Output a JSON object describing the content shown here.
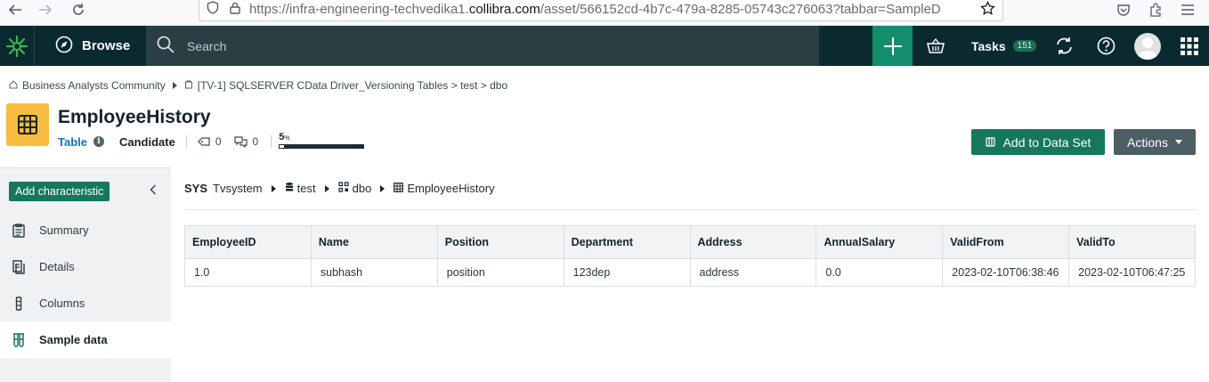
{
  "browser": {
    "url_prefix": "https://infra-engineering-techvedika1.",
    "url_domain": "collibra.com",
    "url_suffix": "/asset/566152cd-4b7c-479a-8285-05743c276063?tabbar=SampleD"
  },
  "header": {
    "browse_label": "Browse",
    "search_placeholder": "Search",
    "tasks_label": "Tasks",
    "tasks_count": "151"
  },
  "breadcrumb": {
    "community": "Business Analysts Community",
    "path": "[TV-1] SQLSERVER CData Driver_Versioning Tables > test > dbo"
  },
  "asset": {
    "title": "EmployeeHistory",
    "type": "Table",
    "status": "Candidate",
    "tags_count": "0",
    "comments_count": "0",
    "completeness_value": "5",
    "completeness_unit": "%",
    "completeness_fraction": 0.05
  },
  "actions": {
    "add_to_dataset": "Add to Data Set",
    "actions": "Actions"
  },
  "sidebar": {
    "add_characteristic": "Add characteristic",
    "items": [
      {
        "label": "Summary",
        "active": false
      },
      {
        "label": "Details",
        "active": false
      },
      {
        "label": "Columns",
        "active": false
      },
      {
        "label": "Sample data",
        "active": true
      }
    ]
  },
  "path": {
    "sys_label": "SYS",
    "system": "Tvsystem",
    "database": "test",
    "schema": "dbo",
    "table": "EmployeeHistory"
  },
  "table": {
    "columns": [
      "EmployeeID",
      "Name",
      "Position",
      "Department",
      "Address",
      "AnnualSalary",
      "ValidFrom",
      "ValidTo"
    ],
    "rows": [
      [
        "1.0",
        "subhash",
        "position",
        "123dep",
        "address",
        "0.0",
        "2023-02-10T06:38:46",
        "2023-02-10T06:47:25"
      ]
    ]
  },
  "colors": {
    "header_bg": "#0a2a30",
    "accent_green": "#15775c",
    "asset_icon": "#f6bd3e",
    "link_blue": "#1473b8"
  }
}
